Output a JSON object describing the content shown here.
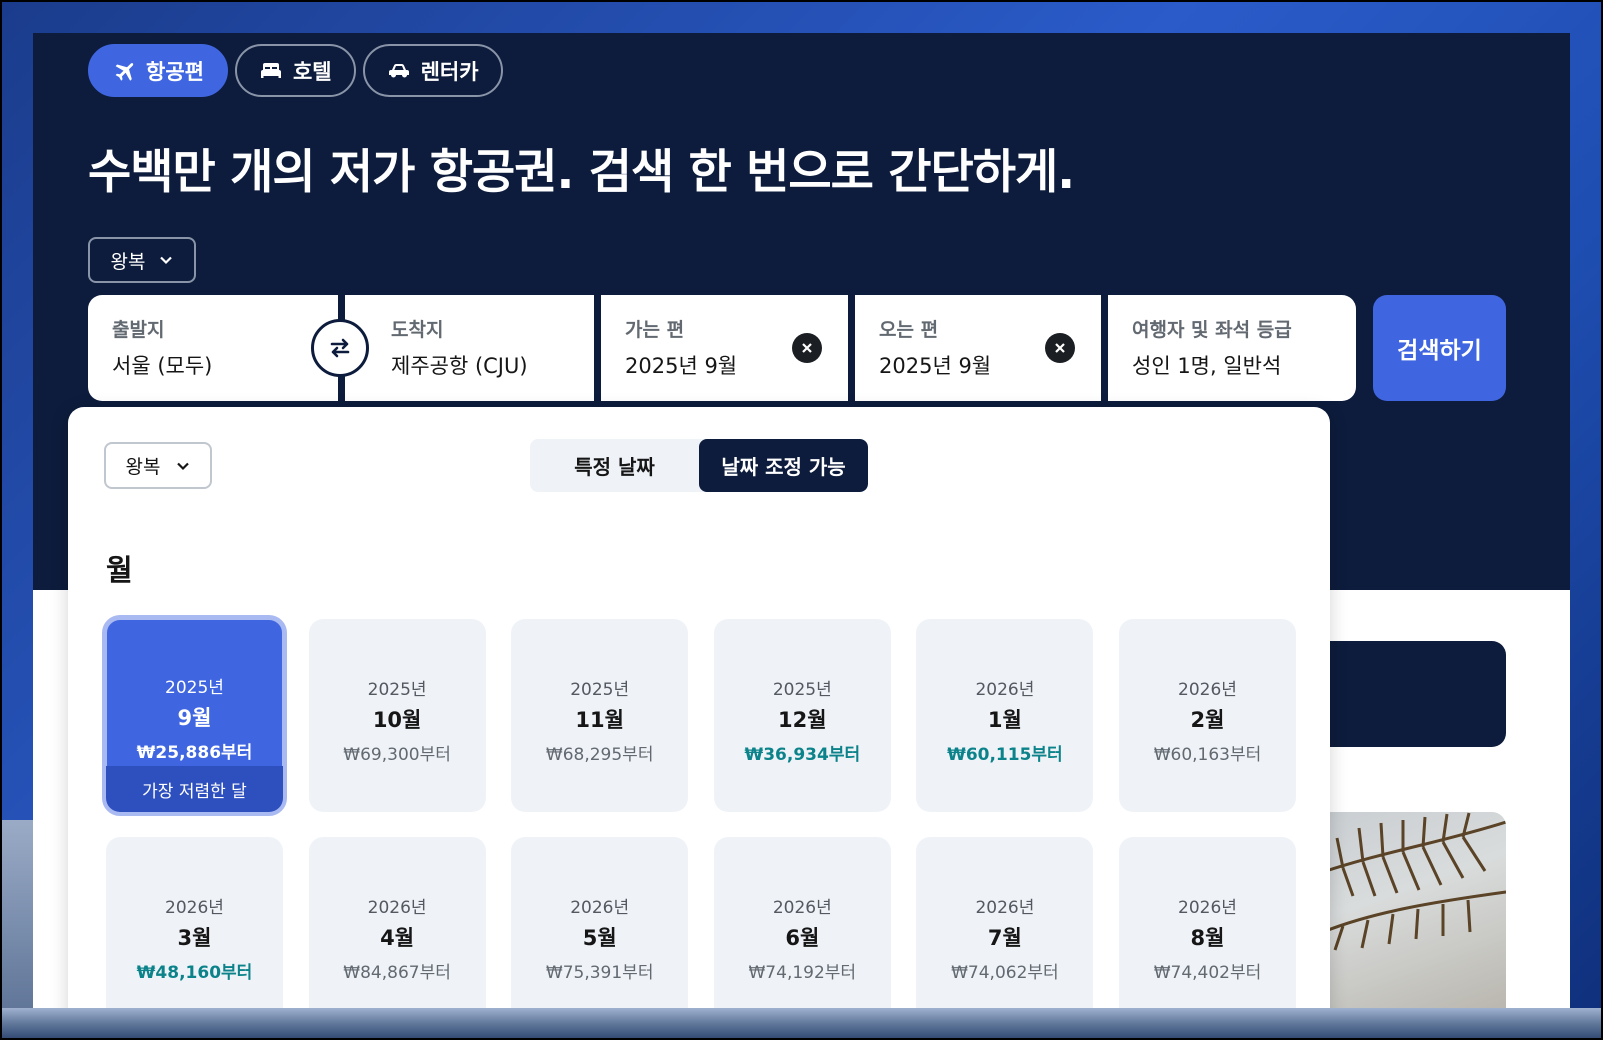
{
  "tabs": [
    {
      "label": "항공편",
      "icon": "airplane-icon",
      "active": true
    },
    {
      "label": "호텔",
      "icon": "bed-icon",
      "active": false
    },
    {
      "label": "렌터카",
      "icon": "car-icon",
      "active": false
    }
  ],
  "headline": "수백만 개의 저가 항공권. 검색 한 번으로 간단하게.",
  "trip_type": "왕복",
  "search": {
    "origin": {
      "label": "출발지",
      "value": "서울 (모두)"
    },
    "destination": {
      "label": "도착지",
      "value": "제주공항 (CJU)"
    },
    "depart": {
      "label": "가는 편",
      "value": "2025년 9월"
    },
    "return": {
      "label": "오는 편",
      "value": "2025년 9월"
    },
    "travelers": {
      "label": "여행자 및 좌석 등급",
      "value": "성인 1명, 일반석"
    },
    "search_button": "검색하기"
  },
  "popup": {
    "trip_type": "왕복",
    "toggle": [
      "특정 날짜",
      "날짜 조정 가능"
    ],
    "toggle_active": 1,
    "section_title": "월",
    "cheapest_label": "가장 저렴한 달",
    "months": [
      {
        "year": "2025년",
        "month": "9월",
        "price": "₩25,886부터",
        "cheap": true,
        "selected": true
      },
      {
        "year": "2025년",
        "month": "10월",
        "price": "₩69,300부터",
        "cheap": false,
        "selected": false
      },
      {
        "year": "2025년",
        "month": "11월",
        "price": "₩68,295부터",
        "cheap": false,
        "selected": false
      },
      {
        "year": "2025년",
        "month": "12월",
        "price": "₩36,934부터",
        "cheap": true,
        "selected": false
      },
      {
        "year": "2026년",
        "month": "1월",
        "price": "₩60,115부터",
        "cheap": true,
        "selected": false
      },
      {
        "year": "2026년",
        "month": "2월",
        "price": "₩60,163부터",
        "cheap": false,
        "selected": false
      },
      {
        "year": "2026년",
        "month": "3월",
        "price": "₩48,160부터",
        "cheap": true,
        "selected": false
      },
      {
        "year": "2026년",
        "month": "4월",
        "price": "₩84,867부터",
        "cheap": false,
        "selected": false
      },
      {
        "year": "2026년",
        "month": "5월",
        "price": "₩75,391부터",
        "cheap": false,
        "selected": false
      },
      {
        "year": "2026년",
        "month": "6월",
        "price": "₩74,192부터",
        "cheap": false,
        "selected": false
      },
      {
        "year": "2026년",
        "month": "7월",
        "price": "₩74,062부터",
        "cheap": false,
        "selected": false
      },
      {
        "year": "2026년",
        "month": "8월",
        "price": "₩74,402부터",
        "cheap": false,
        "selected": false
      }
    ]
  },
  "colors": {
    "hero_bg": "#0d1c3c",
    "accent": "#3f66e0",
    "cheap_price": "#0c838a",
    "cell_bg": "#eff3f8"
  }
}
